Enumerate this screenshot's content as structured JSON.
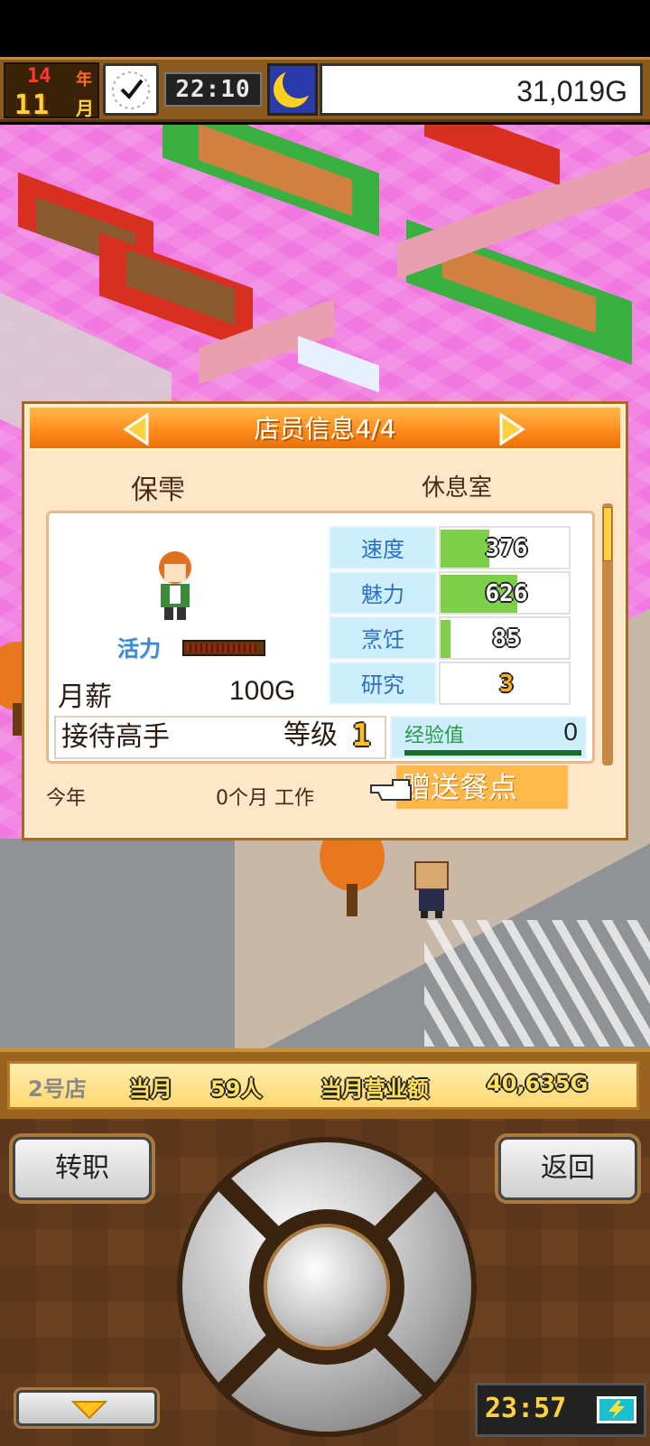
{
  "hud": {
    "year_num": "14",
    "year_label": "年",
    "month_num": "11",
    "month_label": "月",
    "time": "22:10",
    "money": "31,019G"
  },
  "panel": {
    "title": "店员信息4/4",
    "staff_name": "保雫",
    "location": "休息室",
    "energy_label": "活力",
    "energy_level": 0.9,
    "salary_label": "月薪",
    "salary_value": "100G",
    "stats": [
      {
        "label": "速度",
        "value": "376",
        "fill": 0.38
      },
      {
        "label": "魅力",
        "value": "626",
        "fill": 0.6
      },
      {
        "label": "烹饪",
        "value": "85",
        "fill": 0.08
      },
      {
        "label": "研究",
        "value": "3",
        "fill": 0.0
      }
    ],
    "skill_name": "接待高手",
    "level_label": "等级",
    "level_value": "1",
    "exp_label": "经验值",
    "exp_value": "0",
    "year_label": "今年",
    "work_label": "0个月 工作",
    "gift_label": "赠送餐点"
  },
  "infobar": {
    "store": "2号店",
    "month_tag": "当月",
    "customers": "59人",
    "revenue_label": "当月营业额",
    "revenue": "40,635G"
  },
  "controls": {
    "job_label": "转职",
    "back_label": "返回",
    "clock": "23:57"
  },
  "colors": {
    "panel_header": "#ff8a1a",
    "floor": "#f078e0",
    "stat_bar": "#7ed04a"
  }
}
